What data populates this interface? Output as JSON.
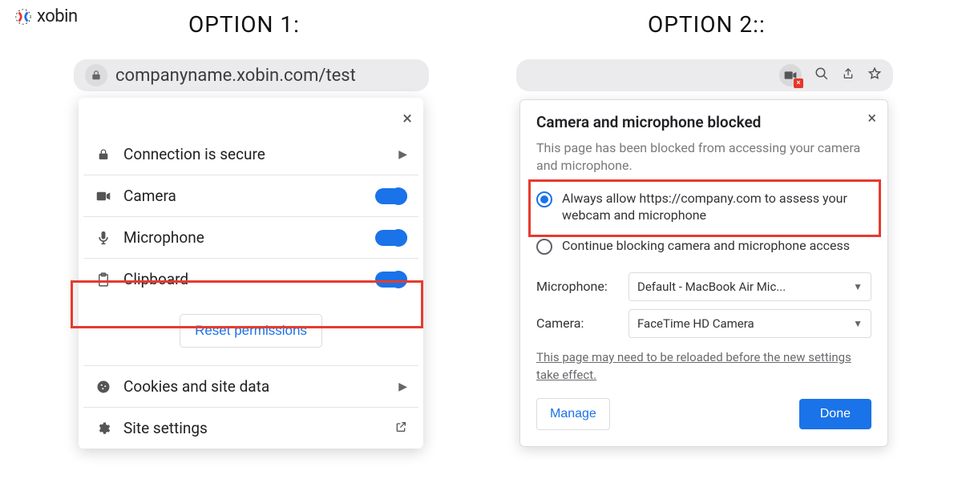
{
  "logo_text": "xobin",
  "headings": {
    "opt1": "OPTION 1:",
    "opt2": "OPTION 2::"
  },
  "option1": {
    "url_text": "companyname.xobin.com/test",
    "rows": {
      "connection": "Connection is secure",
      "camera": "Camera",
      "microphone": "Microphone",
      "clipboard": "Clipboard",
      "cookies": "Cookies and site data",
      "settings": "Site settings"
    },
    "reset_label": "Reset permissions"
  },
  "option2": {
    "dialog_title": "Camera and microphone blocked",
    "dialog_sub": "This page has been blocked from accessing your camera and microphone.",
    "radio_allow": "Always allow https://company.com to assess your webcam and microphone",
    "radio_block": "Continue blocking camera and microphone access",
    "mic_label": "Microphone:",
    "mic_value": "Default - MacBook Air Mic...",
    "cam_label": "Camera:",
    "cam_value": "FaceTime HD Camera",
    "reload_note": "This page may need to be reloaded before the new settings take effect.",
    "manage_label": "Manage",
    "done_label": "Done"
  }
}
